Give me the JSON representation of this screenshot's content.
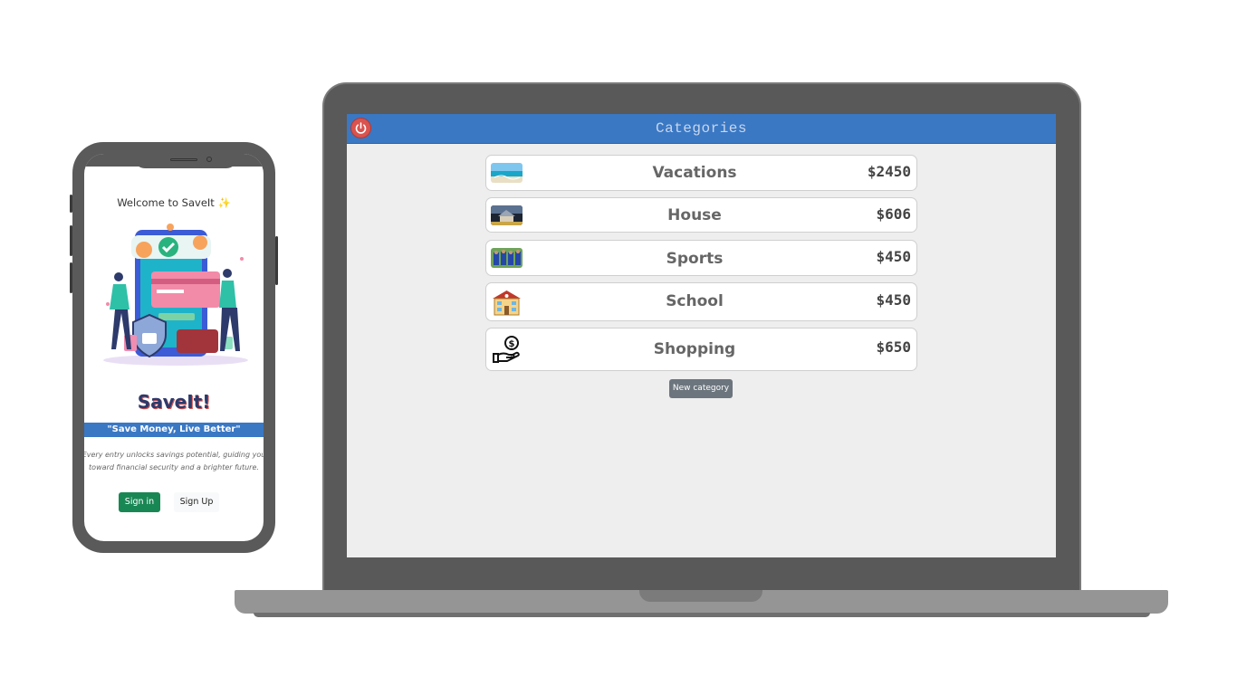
{
  "phone": {
    "welcome": "Welcome to SaveIt ✨",
    "brand": "SaveIt!",
    "tagline": "\"Save Money, Live Better\"",
    "description_line1": "Every entry unlocks savings potential, guiding you",
    "description_line2": "toward financial security and a brighter future.",
    "signin_label": "Sign in",
    "signup_label": "Sign Up",
    "colors": {
      "signin": "#198754",
      "tagline_bg": "#3a78c4"
    }
  },
  "laptop": {
    "header_title": "Categories",
    "power_icon": "power-icon",
    "categories": [
      {
        "name": "Vacations",
        "amount": "$2450",
        "icon": "beach-thumbnail"
      },
      {
        "name": "House",
        "amount": "$606",
        "icon": "house-thumbnail"
      },
      {
        "name": "Sports",
        "amount": "$450",
        "icon": "sports-team-thumbnail"
      },
      {
        "name": "School",
        "amount": "$450",
        "icon": "school-building-icon"
      },
      {
        "name": "Shopping",
        "amount": "$650",
        "icon": "money-hand-icon"
      }
    ],
    "new_category_label": "New category",
    "colors": {
      "header_bg": "#3a78c4",
      "power_btn": "#d9534f",
      "new_category_btn": "#6c757d"
    }
  }
}
